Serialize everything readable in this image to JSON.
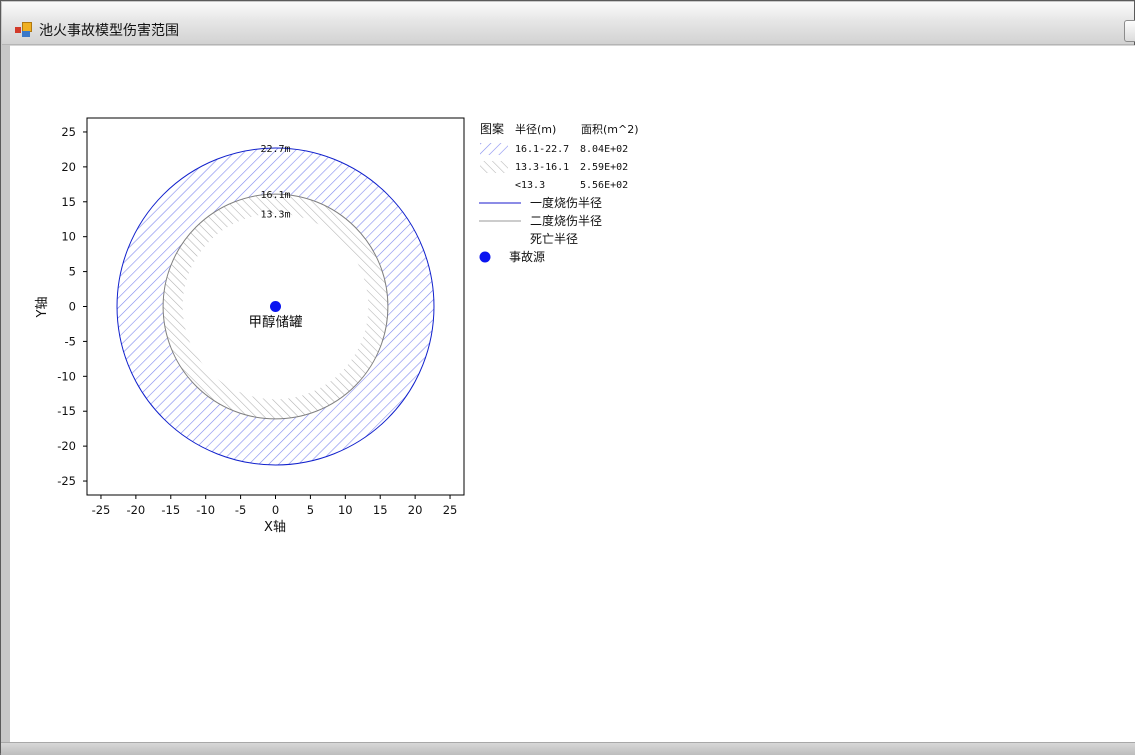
{
  "window": {
    "title": "池火事故模型伤害范围"
  },
  "chart_data": {
    "type": "scatter",
    "xlabel": "X轴",
    "ylabel": "Y轴",
    "xlim": [
      -27,
      27
    ],
    "ylim": [
      -27,
      27
    ],
    "xticks": [
      -25,
      -20,
      -15,
      -10,
      -5,
      0,
      5,
      10,
      15,
      20,
      25
    ],
    "yticks": [
      25,
      20,
      15,
      10,
      5,
      0,
      -5,
      -10,
      -15,
      -20,
      -25
    ],
    "source": {
      "x": 0,
      "y": 0,
      "label": "甲醇储罐",
      "color": "#0a14f0"
    },
    "rings": [
      {
        "key": "first",
        "radius": 22.7,
        "label": "22.7m",
        "color": "#1020cc",
        "fill": "#8890ee"
      },
      {
        "key": "second",
        "radius": 16.1,
        "label": "16.1m",
        "color": "#808080",
        "fill": "#b4b4b4"
      },
      {
        "key": "death",
        "radius": 13.3,
        "label": "13.3m",
        "color": "#ffffff",
        "fill": "#ffffff"
      }
    ],
    "legend": {
      "header": {
        "pattern": "图案",
        "radius": "半径(m)",
        "area": "面积(m^2)"
      },
      "rows": [
        {
          "range": "16.1-22.7",
          "area": "8.04E+02",
          "pattern": "blue-hatch"
        },
        {
          "range": "13.3-16.1",
          "area": "2.59E+02",
          "pattern": "gray-hatch"
        },
        {
          "range": "<13.3",
          "area": "5.56E+02",
          "pattern": "none"
        }
      ],
      "lines": [
        {
          "label": "一度烧伤半径",
          "color": "#1a1acc"
        },
        {
          "label": "二度烧伤半径",
          "color": "#9a9a9a"
        },
        {
          "label": "死亡半径",
          "color": "none"
        }
      ],
      "marker_label": "事故源"
    }
  }
}
